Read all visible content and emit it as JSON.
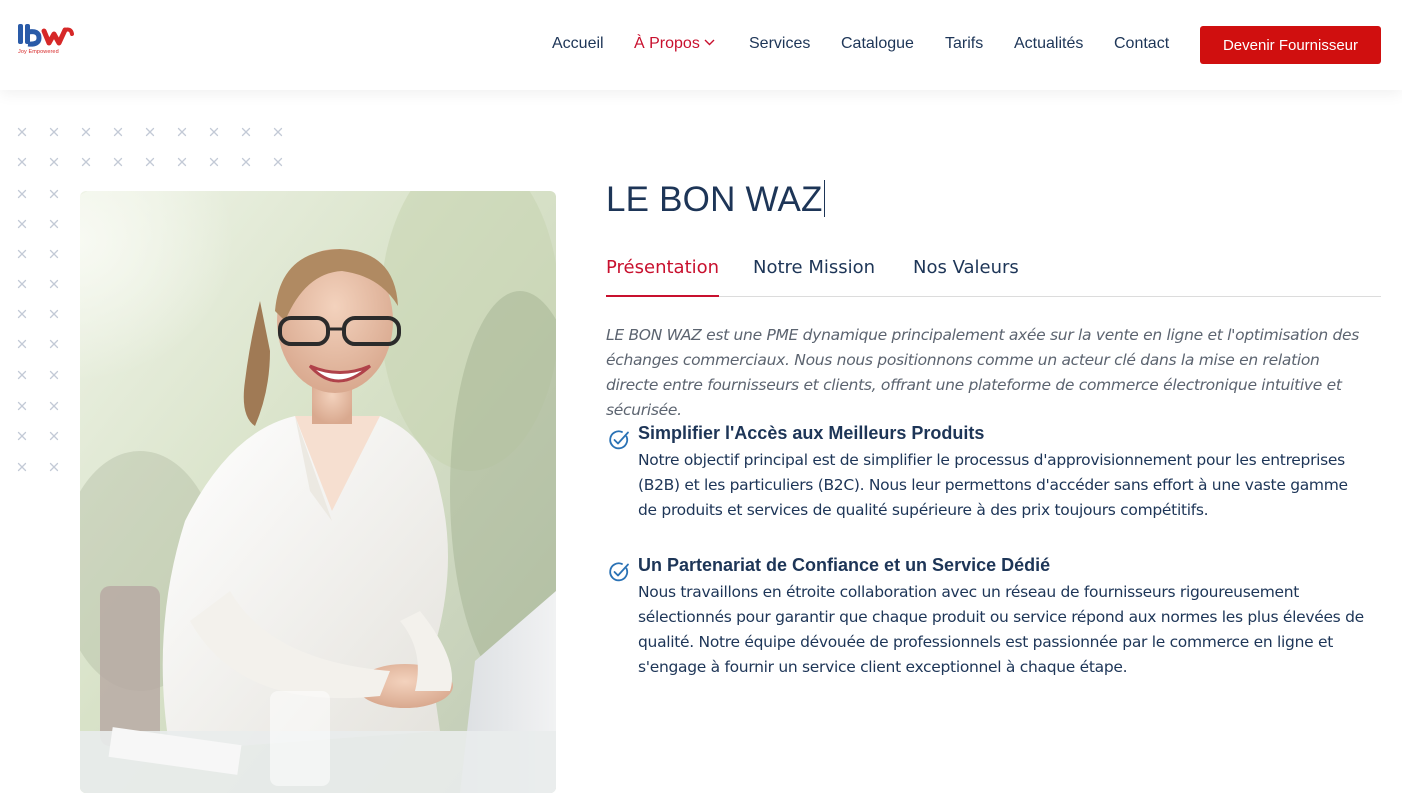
{
  "header": {
    "logo_text": "lbw",
    "logo_tagline": "Joy Empowered",
    "nav": [
      {
        "label": "Accueil"
      },
      {
        "label": "À Propos"
      },
      {
        "label": "Services"
      },
      {
        "label": "Catalogue"
      },
      {
        "label": "Tarifs"
      },
      {
        "label": "Actualités"
      },
      {
        "label": "Contact"
      }
    ],
    "cta_label": "Devenir Fournisseur"
  },
  "main": {
    "title": "LE BON WAZ",
    "tabs": [
      {
        "label": "Présentation"
      },
      {
        "label": "Notre Mission"
      },
      {
        "label": "Nos Valeurs"
      }
    ],
    "intro": "LE BON WAZ est une PME dynamique principalement axée sur la vente en ligne et l'optimisation des échanges commerciaux. Nous nous positionnons comme un acteur clé dans la mise en relation directe entre fournisseurs et clients, offrant une plateforme de commerce électronique intuitive et sécurisée.",
    "features": [
      {
        "title": "Simplifier l'Accès aux Meilleurs Produits",
        "text": "Notre objectif principal est de simplifier le processus d'approvisionnement pour les entreprises (B2B) et les particuliers (B2C). Nous leur permettons d'accéder sans effort à une vaste gamme de produits et services de qualité supérieure à des prix toujours compétitifs."
      },
      {
        "title": "Un Partenariat de Confiance et un Service Dédié",
        "text": "Nous travaillons en étroite collaboration avec un réseau de fournisseurs rigoureusement sélectionnés pour garantir que chaque produit ou service répond aux normes les plus élevées de qualité. Notre équipe dévouée de professionnels est passionnée par le commerce en ligne et s'engage à fournir un service client exceptionnel à chaque étape."
      }
    ]
  },
  "colors": {
    "brand_red": "#d00f0f",
    "navy": "#1d3557",
    "accent_blue": "#2a72b5"
  },
  "icons": [
    "check-circle-icon",
    "chevron-down-icon",
    "x-pattern"
  ]
}
